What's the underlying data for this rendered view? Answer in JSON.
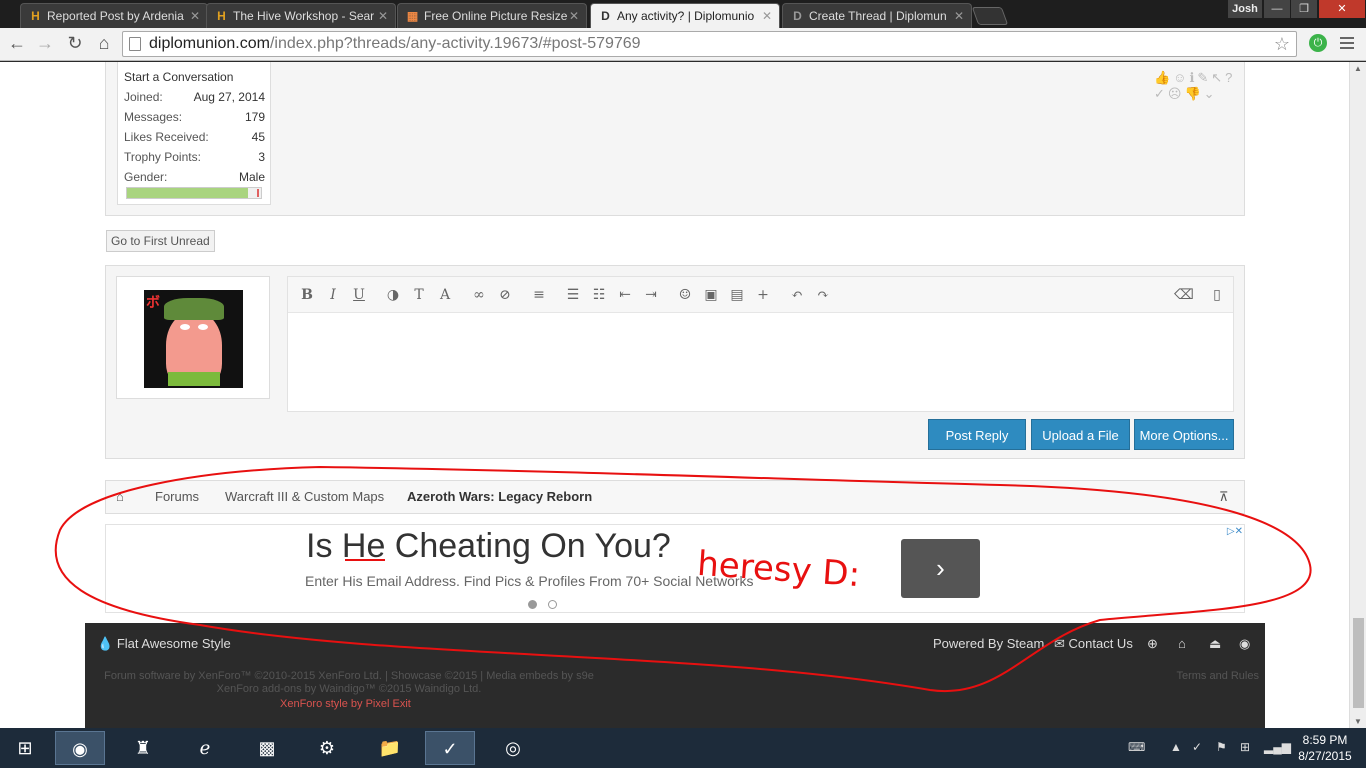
{
  "browser": {
    "tabs": [
      {
        "label": "Reported Post by Ardenia",
        "icon": "hive-icon"
      },
      {
        "label": "The Hive Workshop - Sear",
        "icon": "hive-icon"
      },
      {
        "label": "Free Online Picture Resize",
        "icon": "grid-icon"
      },
      {
        "label": "Any activity? | Diplomunio",
        "icon": "diplomunion-icon",
        "active": true
      },
      {
        "label": "Create Thread | Diplomun",
        "icon": "diplomunion-icon"
      }
    ],
    "user": "Josh",
    "url_domain": "diplomunion.com",
    "url_path": "/index.php?threads/any-activity.19673/#post-579769"
  },
  "profile": {
    "start_conversation": "Start a Conversation",
    "stats": [
      {
        "label": "Joined:",
        "value": "Aug 27, 2014"
      },
      {
        "label": "Messages:",
        "value": "179"
      },
      {
        "label": "Likes Received:",
        "value": "45"
      },
      {
        "label": "Trophy Points:",
        "value": "3"
      },
      {
        "label": "Gender:",
        "value": "Male"
      }
    ],
    "level_fraction": 0.9
  },
  "go_first_unread": "Go to First Unread",
  "editor": {
    "buttons": {
      "post_reply": "Post Reply",
      "upload": "Upload a File",
      "more": "More Options..."
    }
  },
  "breadcrumb": {
    "items": [
      "Forums",
      "Warcraft III & Custom Maps",
      "Azeroth Wars: Legacy Reborn"
    ]
  },
  "ad": {
    "headline": "Is He Cheating On You?",
    "subline": "Enter His Email Address. Find Pics & Profiles From 70+ Social Networks",
    "handwritten": "heresy D:"
  },
  "footer": {
    "style": "Flat Awesome Style",
    "powered": "Powered By Steam",
    "contact": "Contact Us",
    "legal1": "Forum software by XenForo™ ©2010-2015 XenForo Ltd. | Showcase ©2015 | Media embeds by s9e",
    "legal2": "XenForo add-ons by Waindigo™ ©2015 Waindigo Ltd.",
    "style_credit": "XenForo style by Pixel Exit",
    "terms": "Terms and Rules"
  },
  "taskbar": {
    "time": "8:59 PM",
    "date": "8/27/2015"
  }
}
